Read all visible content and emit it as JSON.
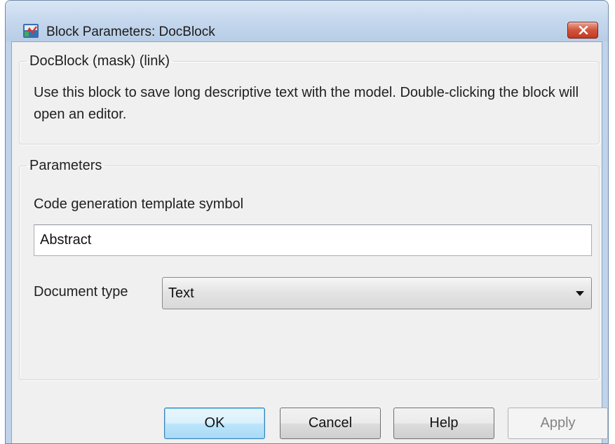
{
  "window": {
    "title": "Block Parameters: DocBlock",
    "app_icon": "simulink-block-icon",
    "close_icon": "close-icon"
  },
  "mask_group": {
    "legend": "DocBlock (mask) (link)",
    "description": "Use this block to save long descriptive text with the model.  Double-clicking the block will open an editor."
  },
  "parameters_group": {
    "legend": "Parameters",
    "template_symbol_label": "Code generation template symbol",
    "template_symbol_value": "Abstract",
    "document_type_label": "Document type",
    "document_type_value": "Text"
  },
  "buttons": {
    "ok": "OK",
    "cancel": "Cancel",
    "help": "Help",
    "apply": "Apply"
  },
  "colors": {
    "frame": "#bfd3ea",
    "client": "#f0f0f0",
    "close_button": "#c94b33",
    "default_button": "#bee6fd"
  }
}
